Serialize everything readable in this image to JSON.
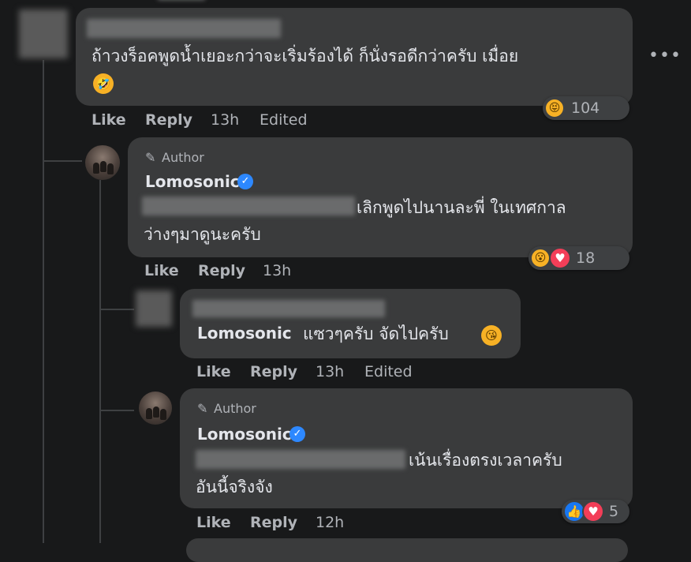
{
  "comment1": {
    "text_line1": "ถ้าวงร็อคพูดน้ำเยอะกว่าจะเริ่มร้องได้ ก็นั่งรอดีกว่าครับ เมื่อย",
    "emoji": "🤣",
    "reactions_count": "104",
    "actions": {
      "like": "Like",
      "reply": "Reply",
      "time": "13h",
      "edited": "Edited"
    },
    "more_icon": "more-options-icon"
  },
  "reply1": {
    "badge": "Author",
    "name": "Lomosonic",
    "text_line1": "เลิกพูดไปนานละพี่ ในเทศกาล",
    "text_line2": "ว่างๆมาดูนะครับ",
    "reactions_count": "18",
    "actions": {
      "like": "Like",
      "reply": "Reply",
      "time": "13h"
    }
  },
  "reply2": {
    "mention": "Lomosonic",
    "text": "แซวๆครับ จัดไปครับ",
    "emoji": "😘",
    "actions": {
      "like": "Like",
      "reply": "Reply",
      "time": "13h",
      "edited": "Edited"
    }
  },
  "reply3": {
    "badge": "Author",
    "name": "Lomosonic",
    "text_line1": "เน้นเรื่องตรงเวลาครับ",
    "text_line2": "อันนี้จริงจัง",
    "reactions_count": "5",
    "actions": {
      "like": "Like",
      "reply": "Reply",
      "time": "12h"
    }
  },
  "colors": {
    "background": "#18191a",
    "bubble": "#3a3b3c",
    "like_blue": "#1877f2",
    "love_red": "#f33e58",
    "verified_blue": "#2d88ff"
  }
}
